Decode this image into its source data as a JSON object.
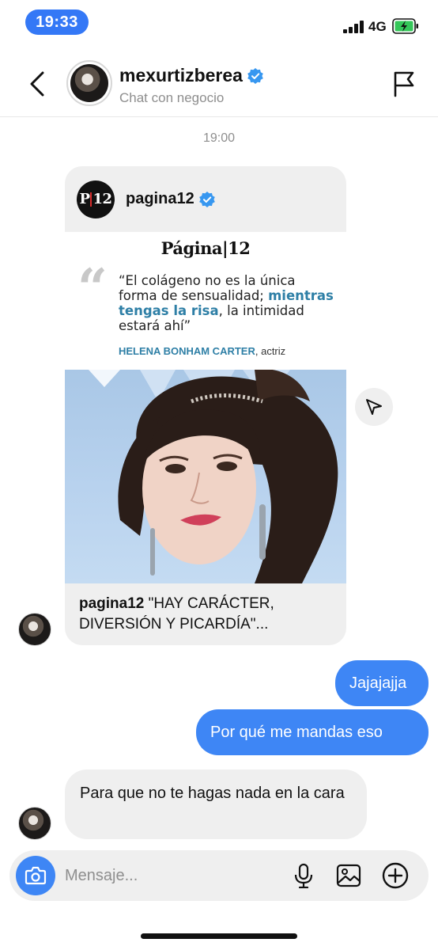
{
  "status_bar": {
    "time": "19:33",
    "network": "4G"
  },
  "header": {
    "username": "mexurtizberea",
    "subtitle": "Chat con negocio",
    "icons": {
      "back": "chevron-left-icon",
      "verified": "verified-badge-icon",
      "report": "flag-icon"
    }
  },
  "thread": {
    "timestamp": "19:00",
    "shared_post": {
      "account": "pagina12",
      "logo_text": "P12",
      "masthead": "Página|12",
      "quote_mark": "“",
      "quote_line_1": "“El colágeno no es la única forma de sensualidad;",
      "quote_highlight": "mientras tengas la risa",
      "quote_line_2": ", la intimidad estará ahí”",
      "quote_author": "HELENA BONHAM CARTER",
      "quote_author_role": ", actriz",
      "caption_account": "pagina12",
      "caption_text": " \"HAY CARÁCTER, DIVERSIÓN Y PICARDÍA\"..."
    },
    "messages": [
      {
        "direction": "outgoing",
        "text": "Jajajajja"
      },
      {
        "direction": "outgoing",
        "text": "Por qué me mandas eso"
      },
      {
        "direction": "incoming",
        "text": "Para que no te hagas nada en la cara"
      }
    ]
  },
  "composer": {
    "placeholder": "Mensaje...",
    "icons": [
      "camera-icon",
      "microphone-icon",
      "gallery-icon",
      "add-circle-icon"
    ]
  },
  "colors": {
    "accent": "#3e86f5",
    "bubble_incoming": "#efefef",
    "quote_highlight": "#2e7fa6",
    "verified": "#3797f0"
  }
}
